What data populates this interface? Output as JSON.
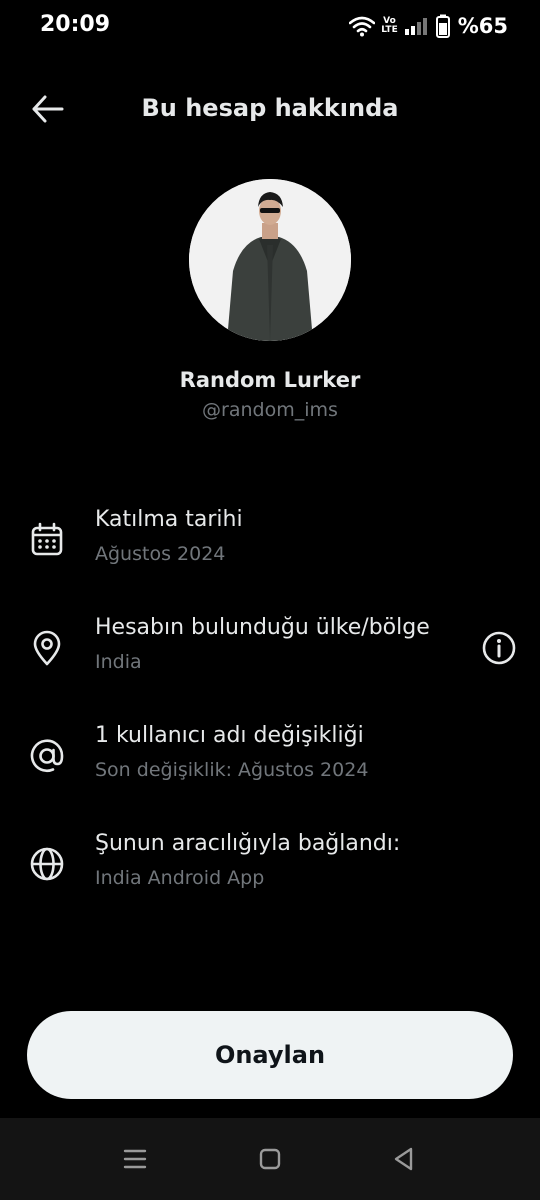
{
  "status_bar": {
    "time": "20:09",
    "volte_top": "Vo",
    "volte_bottom": "LTE",
    "battery": "%65",
    "icons": [
      "wifi-icon",
      "volte-icon",
      "signal-icon",
      "battery-icon"
    ]
  },
  "header": {
    "title": "Bu hesap hakkında",
    "back_icon": "arrow-left-icon"
  },
  "profile": {
    "display_name": "Random Lurker",
    "handle": "@random_ims"
  },
  "info_items": [
    {
      "icon": "calendar-icon",
      "title": "Katılma tarihi",
      "subtitle": "Ağustos 2024"
    },
    {
      "icon": "location-pin-icon",
      "title": "Hesabın bulunduğu ülke/bölge",
      "subtitle": "India",
      "action_icon": "info-icon"
    },
    {
      "icon": "at-sign-icon",
      "title": "1 kullanıcı adı değişikliği",
      "subtitle": "Son değişiklik: Ağustos 2024"
    },
    {
      "icon": "globe-icon",
      "title": "Şunun aracılığıyla bağlandı:",
      "subtitle": "India Android App"
    }
  ],
  "confirm_button": {
    "label": "Onaylan"
  },
  "nav_bar": {
    "icons": [
      "menu-icon",
      "home-square-icon",
      "back-triangle-icon"
    ]
  },
  "colors": {
    "background": "#000000",
    "primary_text": "#e7e9ea",
    "secondary_text": "#71767b",
    "button_bg": "#eff3f4",
    "button_text": "#0f1419",
    "nav_bar_bg": "#141414"
  }
}
